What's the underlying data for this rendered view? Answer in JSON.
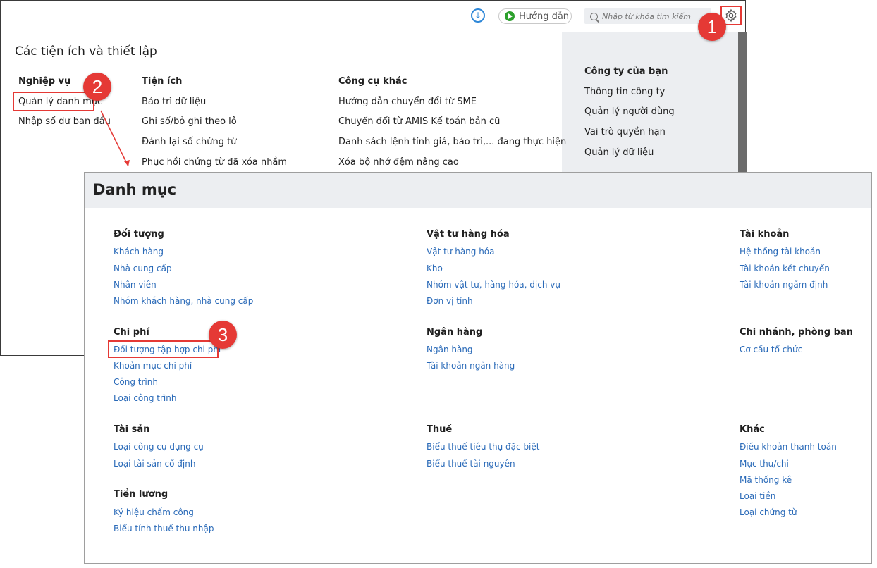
{
  "toolbar": {
    "download_icon": "download-circle-icon",
    "guide_label": "Hướng dẫn",
    "search_placeholder": "Nhập từ khóa tìm kiếm",
    "settings_icon": "gear-icon"
  },
  "badges": [
    "1",
    "2",
    "3"
  ],
  "settings": {
    "title": "Các tiện ích và thiết lập",
    "business": {
      "heading": "Nghiệp vụ",
      "items": [
        "Quản lý danh mục",
        "Nhập số dư ban đầu"
      ]
    },
    "utilities": {
      "heading": "Tiện ích",
      "items": [
        "Bảo trì dữ liệu",
        "Ghi sổ/bỏ ghi theo lô",
        "Đánh lại số chứng từ",
        "Phục hồi chứng từ đã xóa nhầm"
      ]
    },
    "other_tools": {
      "heading": "Công cụ khác",
      "items": [
        "Hướng dẫn chuyển đổi từ SME",
        "Chuyển đổi từ AMIS Kế toán bản cũ",
        "Danh sách lệnh tính giá, bảo trì,... đang thực hiện",
        "Xóa bộ nhớ đệm nâng cao"
      ]
    },
    "company": {
      "heading": "Công ty của bạn",
      "items": [
        "Thông tin công ty",
        "Quản lý người dùng",
        "Vai trò quyền hạn",
        "Quản lý dữ liệu"
      ]
    }
  },
  "catalog": {
    "title": "Danh mục",
    "groups": {
      "objects": {
        "heading": "Đối tượng",
        "items": [
          "Khách hàng",
          "Nhà cung cấp",
          "Nhân viên",
          "Nhóm khách hàng, nhà cung cấp"
        ]
      },
      "materials": {
        "heading": "Vật tư hàng hóa",
        "items": [
          "Vật tư hàng hóa",
          "Kho",
          "Nhóm vật tư, hàng hóa, dịch vụ",
          "Đơn vị tính"
        ]
      },
      "accounts": {
        "heading": "Tài khoản",
        "items": [
          "Hệ thống tài khoản",
          "Tài khoản kết chuyển",
          "Tài khoản ngầm định"
        ]
      },
      "costs": {
        "heading": "Chi phí",
        "items": [
          "Đối tượng tập hợp chi phí",
          "Khoản mục chi phí",
          "Công trình",
          "Loại công trình"
        ]
      },
      "banks": {
        "heading": "Ngân hàng",
        "items": [
          "Ngân hàng",
          "Tài khoản ngân hàng"
        ]
      },
      "branches": {
        "heading": "Chi nhánh, phòng ban",
        "items": [
          "Cơ cấu tổ chức"
        ]
      },
      "assets": {
        "heading": "Tài sản",
        "items": [
          "Loại công cụ dụng cụ",
          "Loại tài sản cố định"
        ]
      },
      "tax": {
        "heading": "Thuế",
        "items": [
          "Biểu thuế tiêu thụ đặc biệt",
          "Biểu thuế tài nguyên"
        ]
      },
      "other": {
        "heading": "Khác",
        "items": [
          "Điều khoản thanh toán",
          "Mục thu/chi",
          "Mã thống kê",
          "Loại tiền",
          "Loại chứng từ"
        ]
      },
      "salary": {
        "heading": "Tiền lương",
        "items": [
          "Ký hiệu chấm công",
          "Biểu tính thuế thu nhập"
        ]
      }
    }
  },
  "colors": {
    "highlight": "#e53935",
    "link": "#2a6ab8",
    "panel_bg": "#eceef1"
  }
}
